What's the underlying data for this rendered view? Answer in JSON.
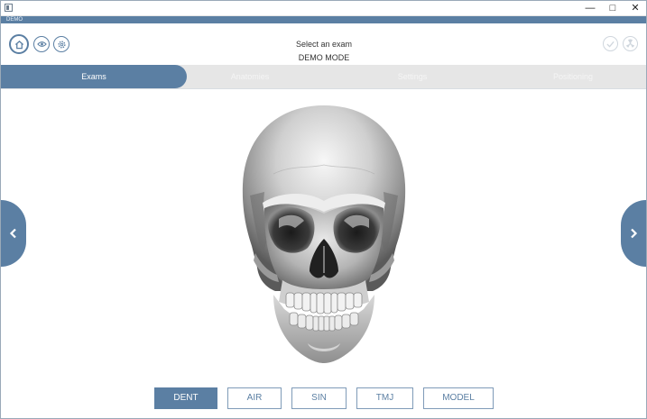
{
  "window": {
    "title": "",
    "controls": {
      "minimize": "—",
      "maximize": "□",
      "close": "✕"
    }
  },
  "app_bar": {
    "label": "DEMO"
  },
  "header": {
    "title": "Select an exam",
    "subtitle": "DEMO MODE",
    "left_buttons": [
      "home-icon",
      "eye-icon",
      "gear-icon"
    ],
    "right_buttons": [
      "check-icon",
      "radiation-icon"
    ]
  },
  "tabs": [
    {
      "label": "Exams",
      "active": true
    },
    {
      "label": "Anatomies",
      "active": false
    },
    {
      "label": "Settings",
      "active": false
    },
    {
      "label": "Positioning",
      "active": false
    }
  ],
  "viewer": {
    "prev_icon": "chevron-left-icon",
    "next_icon": "chevron-right-icon",
    "model": "skull-3d"
  },
  "exam_types": [
    {
      "label": "DENT",
      "active": true
    },
    {
      "label": "AIR",
      "active": false
    },
    {
      "label": "SIN",
      "active": false
    },
    {
      "label": "TMJ",
      "active": false
    },
    {
      "label": "MODEL",
      "active": false
    }
  ],
  "colors": {
    "accent": "#5b7fa3",
    "tab_bar": "#e6e6e6",
    "background": "#ffffff"
  }
}
